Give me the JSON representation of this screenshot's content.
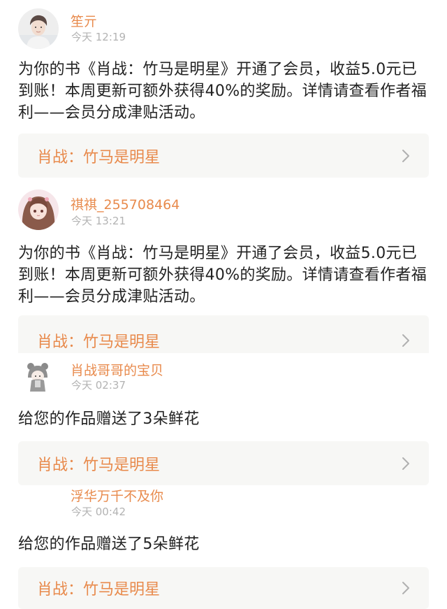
{
  "notifications": [
    {
      "sender": "笙亓",
      "time": "今天 12:19",
      "text": "为你的书《肖战：竹马是明星》开通了会员，收益5.0元已到账！本周更新可额外获得40%的奖励。详情请查看作者福利——会员分成津贴活动。",
      "book": "肖战：竹马是明星",
      "avatar_icon": "boy-portrait-icon"
    },
    {
      "sender": "祺祺_255708464",
      "time": "今天 13:21",
      "text": "为你的书《肖战：竹马是明星》开通了会员，收益5.0元已到账！本周更新可额外获得40%的奖励。详情请查看作者福利——会员分成津贴活动。",
      "book": "肖战：竹马是明星",
      "avatar_icon": "anime-girl-portrait-icon"
    },
    {
      "sender": "肖战哥哥的宝贝",
      "time": "今天 02:37",
      "text": "给您的作品赠送了3朵鲜花",
      "book": "肖战：竹马是明星",
      "avatar_icon": "cartoon-bear-hoodie-icon"
    },
    {
      "sender": "浮华万千不及你",
      "time": "今天 00:42",
      "text": "给您的作品赠送了5朵鲜花",
      "book": "肖战：竹马是明星",
      "avatar_icon": "blank-avatar-icon"
    }
  ],
  "colors": {
    "accent": "#e88a4c",
    "time": "#b3b3b3",
    "card_bg": "#f7f7f5",
    "text": "#222222"
  }
}
